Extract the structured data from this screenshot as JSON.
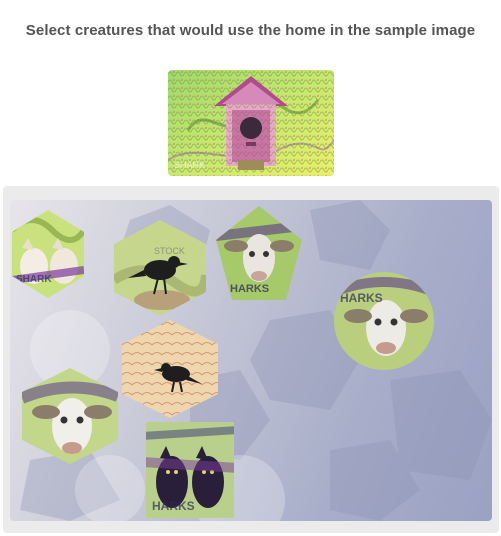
{
  "prompt": {
    "text": "Select creatures that would use the home in the sample image"
  },
  "sample_image": {
    "icon": "birdhouse-icon"
  },
  "tokens": [
    {
      "shape": "hexagon",
      "creature": "cats-icon"
    },
    {
      "shape": "hexagon",
      "creature": "crow-icon"
    },
    {
      "shape": "pentagon",
      "creature": "goat-icon"
    },
    {
      "shape": "circle",
      "creature": "goat-icon"
    },
    {
      "shape": "hexagon",
      "creature": "crow-icon"
    },
    {
      "shape": "hexagon",
      "creature": "goat-icon"
    },
    {
      "shape": "square",
      "creature": "cats-icon"
    }
  ],
  "colors": {
    "prompt_text": "#555555",
    "panel_bg": "#ebebeb",
    "stage_bg": "#a9afca"
  }
}
